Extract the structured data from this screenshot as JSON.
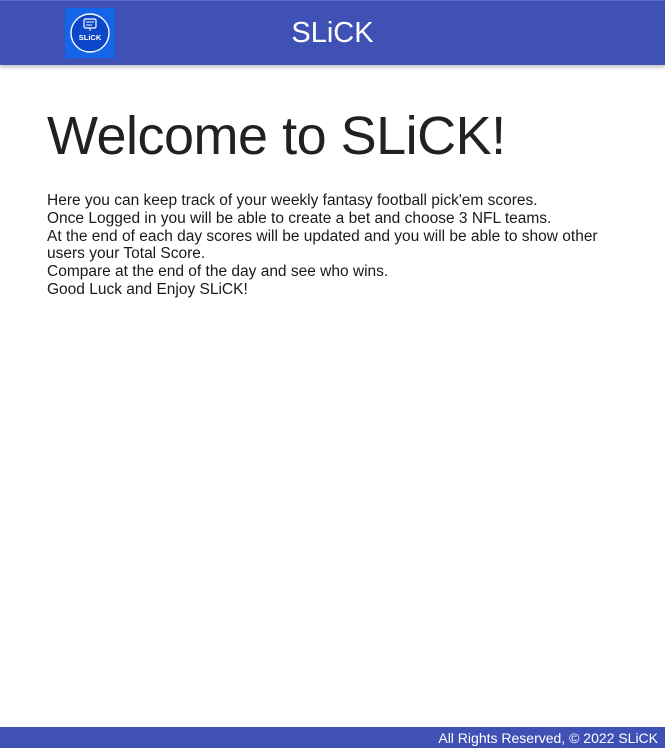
{
  "header": {
    "logo_text": "SLiCK",
    "title": "SLiCK"
  },
  "main": {
    "heading": "Welcome to SLiCK!",
    "paragraphs": [
      "Here you can keep track of your weekly fantasy football pick'em scores.",
      "Once Logged in you will be able to create a bet and choose 3 NFL teams.",
      "At the end of each day scores will be updated and you will be able to show other users your Total Score.",
      "Compare at the end of the day and see who wins.",
      "Good Luck and Enjoy SLiCK!"
    ]
  },
  "footer": {
    "copyright": "All Rights Reserved, © 2022 SLiCK"
  },
  "colors": {
    "header_bg": "#3f51b5",
    "logo_bg": "#1565e8",
    "footer_bg": "#3f51b5",
    "text": "#212121"
  }
}
